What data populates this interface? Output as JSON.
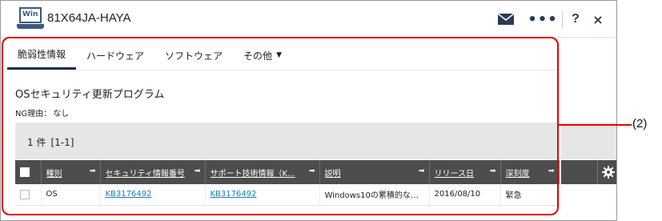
{
  "window": {
    "os_badge": "Win",
    "title": "81X64JA-HAYA",
    "icons": [
      "mail-icon",
      "more-icon",
      "help-icon",
      "close-icon"
    ],
    "help_glyph": "?",
    "close_glyph": "×"
  },
  "tabs": [
    {
      "label": "脆弱性情報",
      "active": true
    },
    {
      "label": "ハードウェア",
      "active": false
    },
    {
      "label": "ソフトウェア",
      "active": false
    },
    {
      "label": "その他",
      "active": false,
      "dropdown": true
    }
  ],
  "section": {
    "title": "OSセキュリティ更新プログラム",
    "ng_label": "NG理由：",
    "ng_value": "なし"
  },
  "results": {
    "count": "1 件",
    "range": "[1-1]"
  },
  "table": {
    "columns": [
      "種別",
      "セキュリティ情報番号",
      "サポート技術情報（K...",
      "説明",
      "リリース日",
      "深刻度"
    ],
    "rows": [
      [
        "OS",
        "KB3176492",
        "KB3176492",
        "Windows10の累積的な更新...",
        "2016/08/10",
        "緊急"
      ]
    ]
  },
  "annotation": {
    "label": "(2)",
    "color": "#e60000"
  },
  "colors": {
    "header_dark": "#4d4d4d",
    "link": "#1a7fbf",
    "accent": "#1d2e4f"
  }
}
